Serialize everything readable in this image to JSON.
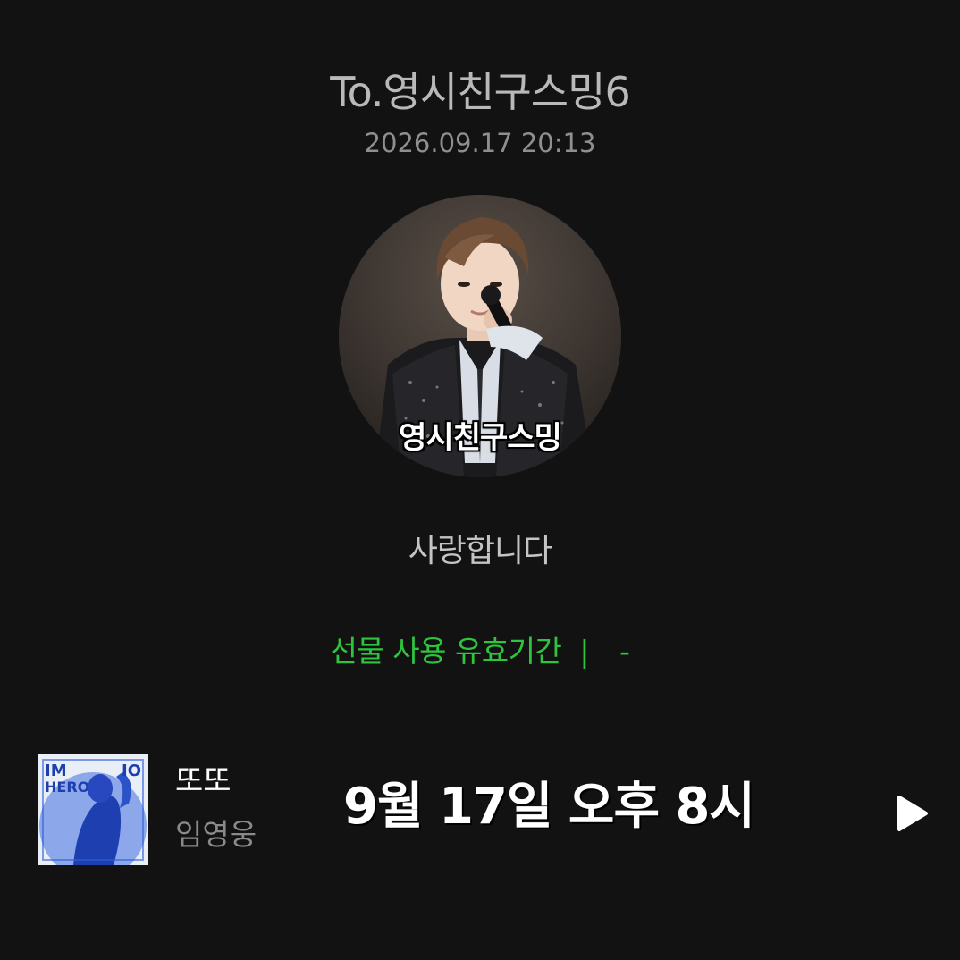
{
  "gift": {
    "recipient": "To.영시친구스밍6",
    "sent_date": "2026.09.17 20:13",
    "message": "사랑합니다",
    "validity_label": "선물 사용 유효기간",
    "validity_separator": "|",
    "validity_value": "-"
  },
  "avatar": {
    "caption": "영시친구스밍",
    "icon": "singer-photo"
  },
  "music": {
    "album_art_text_1": "IM",
    "album_art_text_2": "HERO",
    "album_art_text_3": "IO",
    "title": "또또",
    "artist": "임영웅",
    "release_time": "9월 17일 오후 8시",
    "play_icon": "play-icon"
  },
  "colors": {
    "background": "#121212",
    "accent_green": "#2fc43d",
    "album_blue": "#2f5fd8"
  }
}
